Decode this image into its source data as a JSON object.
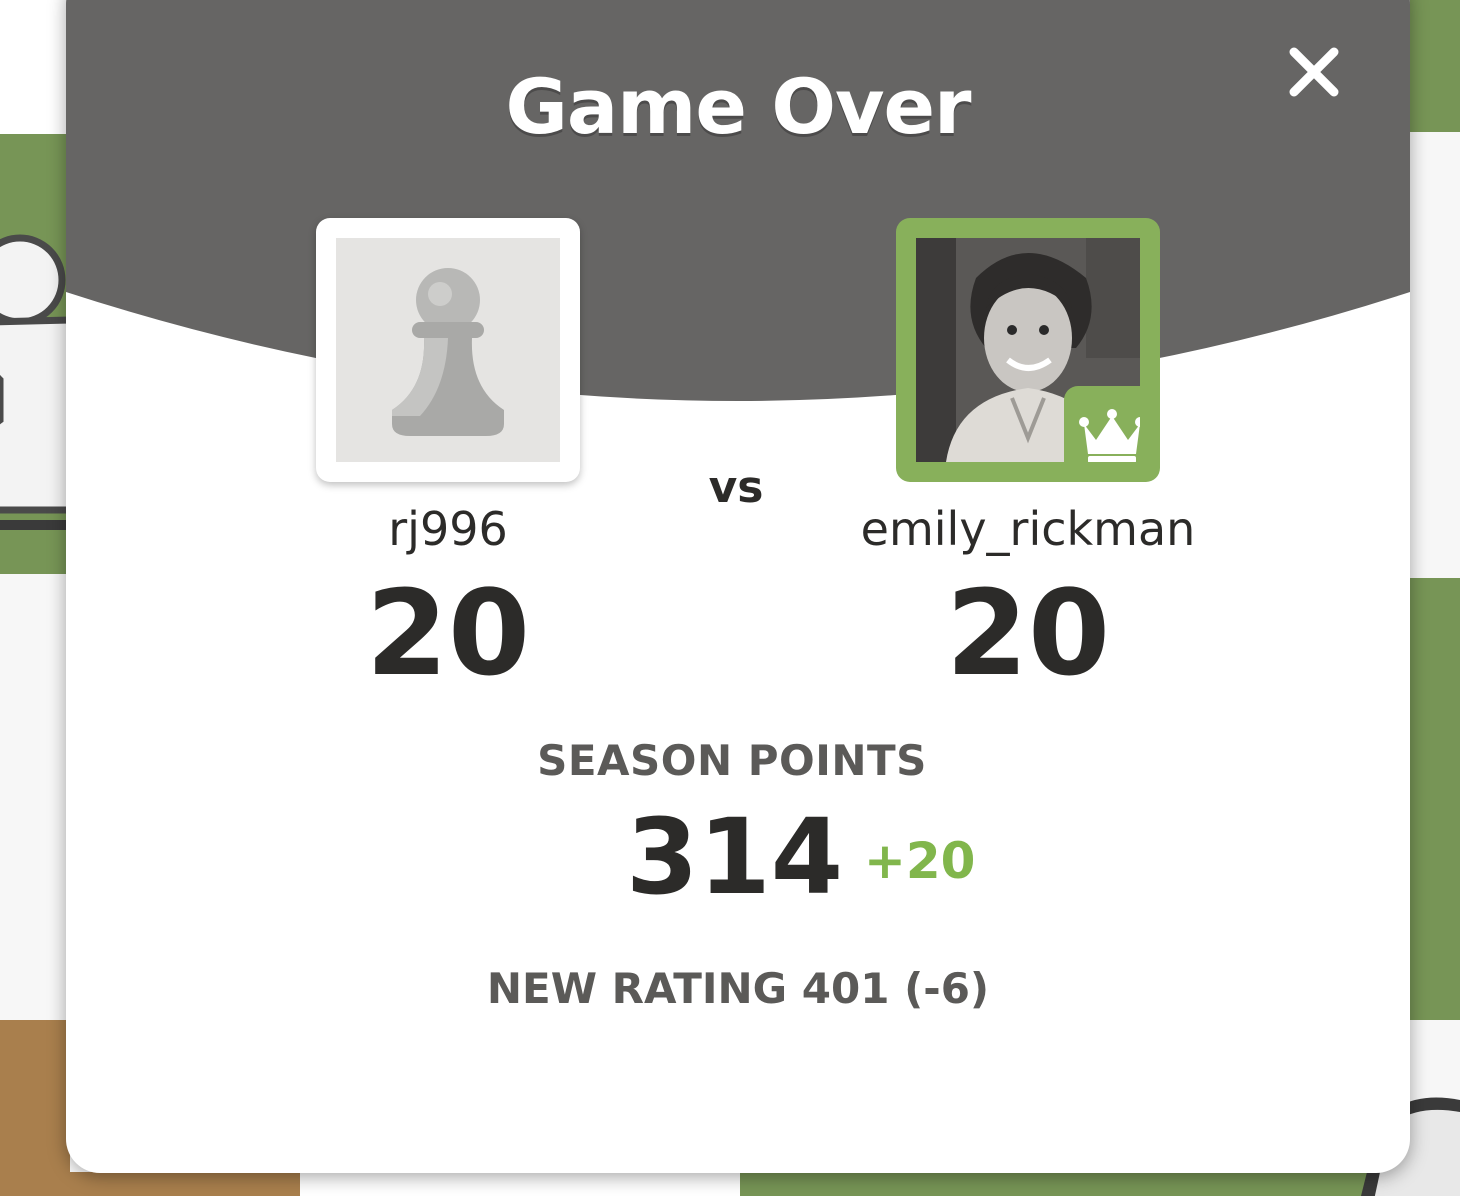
{
  "modal": {
    "title": "Game Over",
    "close_icon": "close-icon",
    "header_color": "#666564"
  },
  "player_left": {
    "username": "rj996",
    "score": "20",
    "avatar_icon": "pawn-icon"
  },
  "vs_label": "vs",
  "player_right": {
    "username": "emily_rickman",
    "score": "20",
    "avatar_icon": "user-photo",
    "badge_icon": "crown-icon",
    "accent_color": "#88b05b"
  },
  "season": {
    "label": "SEASON POINTS",
    "points": "314",
    "delta": "+20",
    "delta_color": "#81b64c"
  },
  "rating": {
    "text": "NEW RATING 401 (-6)"
  }
}
